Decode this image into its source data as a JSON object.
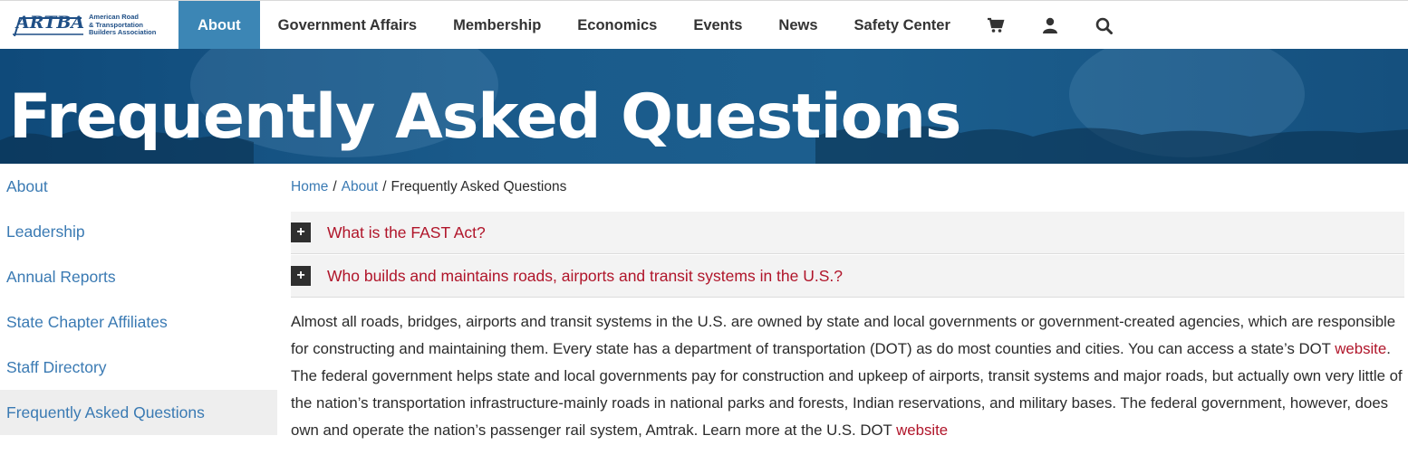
{
  "logo": {
    "mark": "ARTBA",
    "org_line1": "American Road",
    "org_line2": "& Transportation",
    "org_line3": "Builders Association"
  },
  "nav": {
    "items": [
      {
        "label": "About",
        "active": true
      },
      {
        "label": "Government Affairs"
      },
      {
        "label": "Membership"
      },
      {
        "label": "Economics"
      },
      {
        "label": "Events"
      },
      {
        "label": "News"
      },
      {
        "label": "Safety Center"
      }
    ],
    "icons": [
      "cart-icon",
      "user-icon",
      "search-icon"
    ]
  },
  "hero": {
    "title": "Frequently Asked Questions"
  },
  "sidebar": {
    "items": [
      {
        "label": "About"
      },
      {
        "label": "Leadership"
      },
      {
        "label": "Annual Reports"
      },
      {
        "label": "State Chapter Affiliates"
      },
      {
        "label": "Staff Directory"
      },
      {
        "label": "Frequently Asked Questions",
        "current": true
      }
    ]
  },
  "breadcrumb": {
    "home": "Home",
    "about": "About",
    "current": "Frequently Asked Questions",
    "separator": "/"
  },
  "faqs": [
    {
      "toggle": "+",
      "question": "What is the FAST Act?"
    },
    {
      "toggle": "+",
      "question": "Who builds and maintains roads, airports and transit systems in the U.S.?"
    }
  ],
  "answer": {
    "part1": "Almost all roads, bridges, airports and transit systems in the U.S. are owned by state and local governments or government-created agencies, which are responsible for constructing and maintaining them. Every state has a department of transportation (DOT) as do most counties and cities. You can access a state’s DOT ",
    "link1": "website",
    "part2": ". The federal government helps state and local governments pay for construction and upkeep of airports, transit systems and major roads, but actually own very little of the nation’s transportation infrastructure-mainly roads in national parks and forests, Indian reservations, and military bases. The federal government, however, does own and operate the nation’s passenger rail system, Amtrak. Learn more at the U.S. DOT ",
    "link2": "website"
  },
  "colors": {
    "nav_active": "#3c86b5",
    "hero": "#1a5a8a",
    "link": "#3a7ab3",
    "faq_link": "#b0152a"
  }
}
